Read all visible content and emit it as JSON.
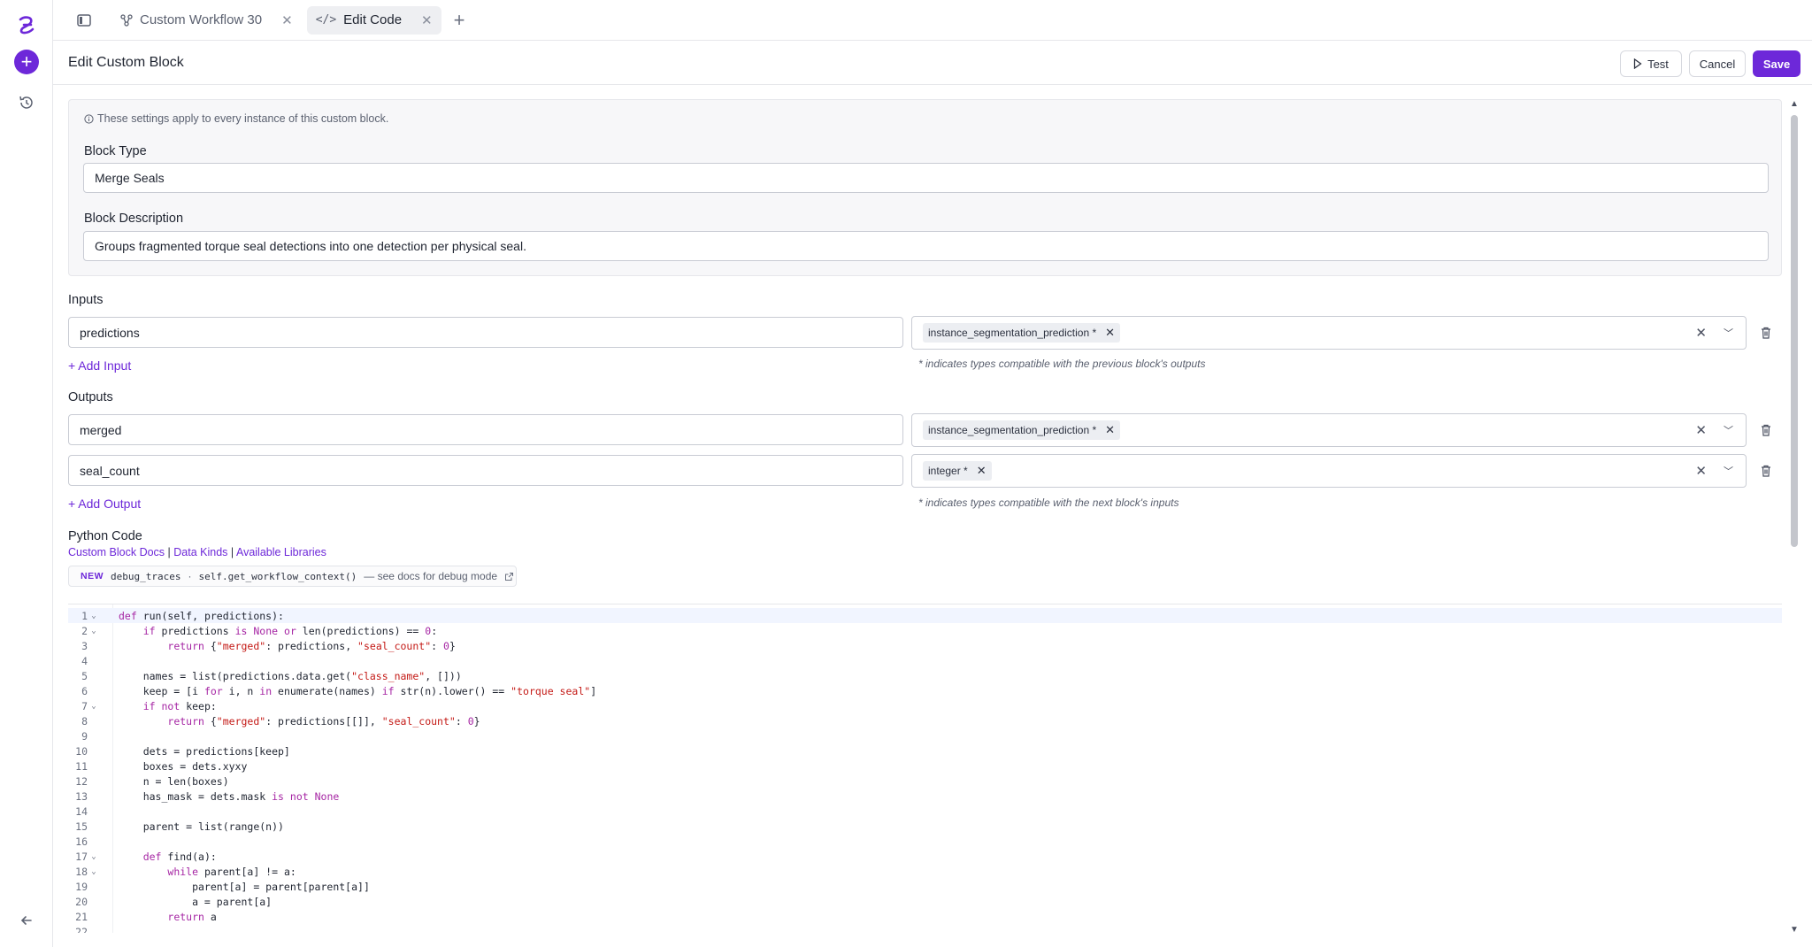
{
  "tabs": [
    {
      "label": "Custom Workflow 30",
      "icon": "workflow-icon",
      "active": false
    },
    {
      "label": "Edit Code",
      "icon": "code-icon",
      "active": true
    }
  ],
  "header": {
    "title": "Edit Custom Block",
    "test_label": "Test",
    "cancel_label": "Cancel",
    "save_label": "Save"
  },
  "settings": {
    "note": "These settings apply to every instance of this custom block.",
    "block_type_label": "Block Type",
    "block_type_value": "Merge Seals",
    "block_description_label": "Block Description",
    "block_description_value": "Groups fragmented torque seal detections into one detection per physical seal."
  },
  "inputs": {
    "label": "Inputs",
    "items": [
      {
        "name": "predictions",
        "type": "instance_segmentation_prediction *"
      }
    ],
    "add_label": "+ Add Input",
    "hint": "* indicates types compatible with the previous block's outputs"
  },
  "outputs": {
    "label": "Outputs",
    "items": [
      {
        "name": "merged",
        "type": "instance_segmentation_prediction *"
      },
      {
        "name": "seal_count",
        "type": "integer *"
      }
    ],
    "add_label": "+ Add Output",
    "hint": "* indicates types compatible with the next block's inputs"
  },
  "python": {
    "label": "Python Code",
    "links": [
      "Custom Block Docs",
      "Data Kinds",
      "Available Libraries"
    ],
    "new_badge": "NEW",
    "new_code_1": "debug_traces",
    "new_sep": "·",
    "new_code_2": "self.get_workflow_context()",
    "new_text": "— see docs for debug mode"
  },
  "code_lines": [
    "def run(self, predictions):",
    "    if predictions is None or len(predictions) == 0:",
    "        return {\"merged\": predictions, \"seal_count\": 0}",
    "",
    "    names = list(predictions.data.get(\"class_name\", []))",
    "    keep = [i for i, n in enumerate(names) if str(n).lower() == \"torque seal\"]",
    "    if not keep:",
    "        return {\"merged\": predictions[[]], \"seal_count\": 0}",
    "",
    "    dets = predictions[keep]",
    "    boxes = dets.xyxy",
    "    n = len(boxes)",
    "    has_mask = dets.mask is not None",
    "",
    "    parent = list(range(n))",
    "",
    "    def find(a):",
    "        while parent[a] != a:",
    "            parent[a] = parent[parent[a]]",
    "            a = parent[a]",
    "        return a",
    ""
  ],
  "fold_lines": [
    1,
    2,
    7,
    17,
    18
  ]
}
